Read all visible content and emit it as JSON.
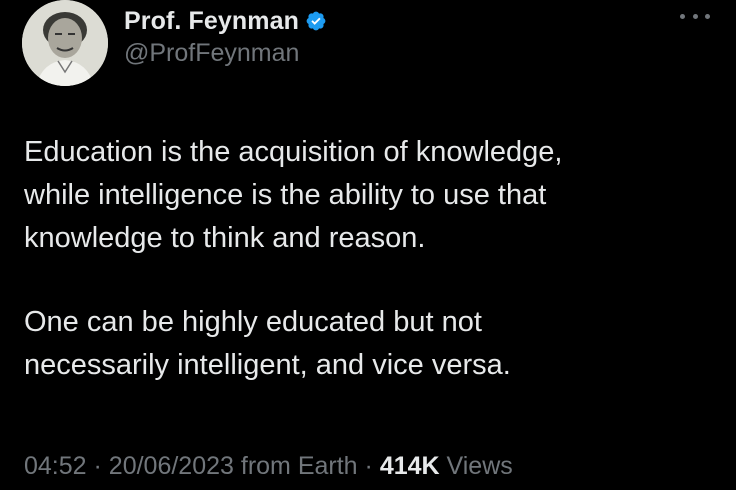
{
  "author": {
    "display_name": "Prof. Feynman",
    "handle": "@ProfFeynman",
    "verified": true,
    "avatar": "profile-photo"
  },
  "tweet": {
    "paragraphs": [
      "Education is the acquisition of knowledge,\nwhile intelligence is the ability to use that\nknowledge to think and reason.",
      "One can be highly educated but not\nnecessarily intelligent, and vice versa."
    ],
    "time": "04:52",
    "date": "20/06/2023",
    "source": "from Earth",
    "separator": "·",
    "views_count": "414K",
    "views_label": "Views"
  },
  "icons": {
    "verified": "verified-badge-icon",
    "more": "more-options-icon"
  },
  "colors": {
    "background": "#000000",
    "text_primary": "#e7e9ea",
    "text_secondary": "#71767b",
    "verified_blue": "#1d9bf0"
  }
}
